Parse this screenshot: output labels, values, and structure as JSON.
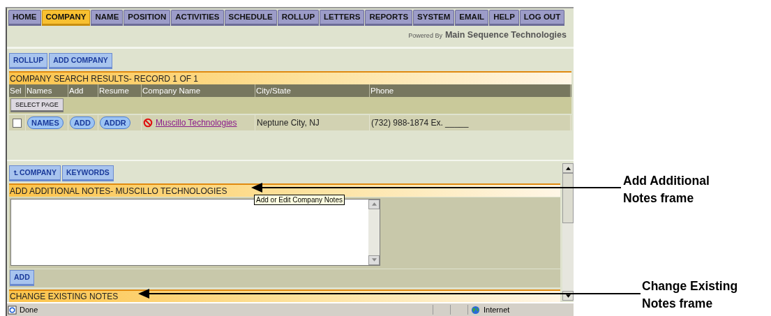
{
  "top_tabs": [
    {
      "label": "HOME",
      "selected": false
    },
    {
      "label": "COMPANY",
      "selected": true
    },
    {
      "label": "NAME",
      "selected": false
    },
    {
      "label": "POSITION",
      "selected": false
    },
    {
      "label": "ACTIVITIES",
      "selected": false
    },
    {
      "label": "SCHEDULE",
      "selected": false
    },
    {
      "label": "ROLLUP",
      "selected": false
    },
    {
      "label": "LETTERS",
      "selected": false
    },
    {
      "label": "REPORTS",
      "selected": false
    },
    {
      "label": "SYSTEM",
      "selected": false
    },
    {
      "label": "EMAIL",
      "selected": false
    },
    {
      "label": "HELP",
      "selected": false
    },
    {
      "label": "LOG OUT",
      "selected": false
    }
  ],
  "powered_by": {
    "prefix": "Powered By",
    "name": "Main Sequence Technologies"
  },
  "results_frame": {
    "tabs": [
      "ROLLUP",
      "ADD COMPANY"
    ],
    "header": "COMPANY SEARCH RESULTS- RECORD 1 OF 1",
    "columns": [
      "Sel",
      "Names",
      "Add",
      "Resume",
      "Company Name",
      "City/State",
      "Phone"
    ],
    "select_page": "SELECT PAGE",
    "rows": [
      {
        "checked": false,
        "buttons": [
          "NAMES",
          "ADD",
          "ADDR"
        ],
        "company": "Muscillo Technologies",
        "city_state": "Neptune City, NJ",
        "phone": "(732) 988-1874 Ex. _____"
      }
    ]
  },
  "notes_frame": {
    "tabs": [
      {
        "label": "COMPANY",
        "kind": "up"
      },
      {
        "label": "KEYWORDS",
        "kind": "plain"
      }
    ],
    "add_header": "ADD ADDITIONAL NOTES- MUSCILLO TECHNOLOGIES",
    "tooltip": "Add or Edit Company Notes",
    "add_button": "ADD",
    "change_header": "CHANGE EXISTING NOTES"
  },
  "status_bar": {
    "text": "Done",
    "zone": "Internet"
  },
  "callouts": [
    {
      "text": "Add Additional Notes frame"
    },
    {
      "text": "Change Existing Notes frame"
    }
  ]
}
